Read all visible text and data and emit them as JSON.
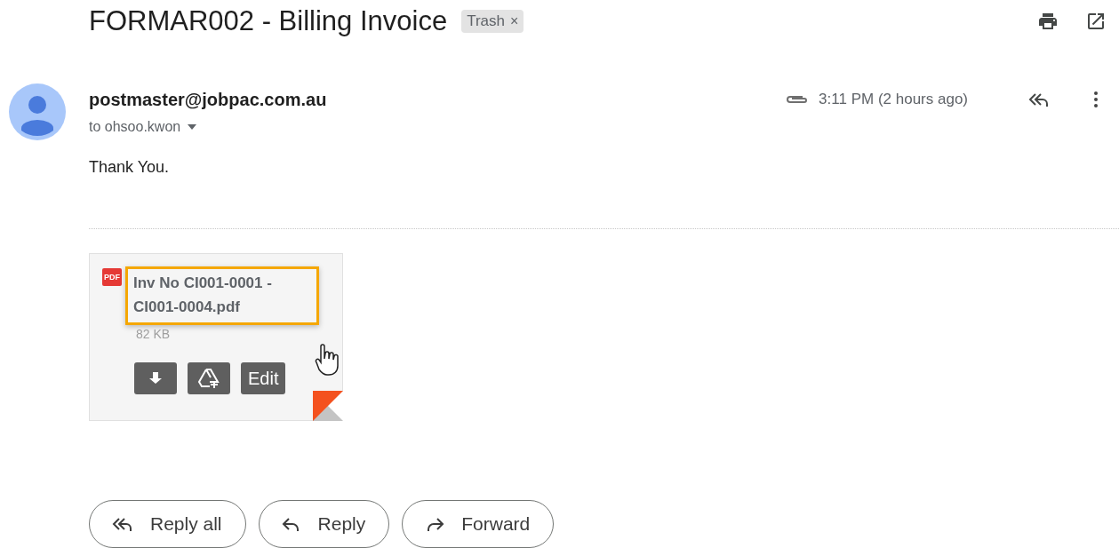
{
  "subject": {
    "title": "FORMAR002 - Billing Invoice",
    "label": {
      "text": "Trash",
      "close": "×"
    }
  },
  "header_actions": [
    {
      "kind": "print"
    },
    {
      "kind": "open_new"
    }
  ],
  "message": {
    "sender": "postmaster@jobpac.com.au",
    "recipient": "to ohsoo.kwon",
    "has_attachment": true,
    "time": "3:11 PM (2 hours ago)",
    "body": "Thank You."
  },
  "attachment": {
    "name": "Inv No CI001-0001 - CI001-0004.pdf",
    "file_badge": "PDF",
    "size": "82 KB",
    "highlighted": true,
    "actions": [
      {
        "kind": "download"
      },
      {
        "kind": "drive"
      },
      {
        "kind": "edit",
        "label": "Edit"
      }
    ]
  },
  "footer_buttons": [
    {
      "kind": "reply_all",
      "label": "Reply all"
    },
    {
      "kind": "reply",
      "label": "Reply"
    },
    {
      "kind": "forward",
      "label": "Forward"
    }
  ]
}
